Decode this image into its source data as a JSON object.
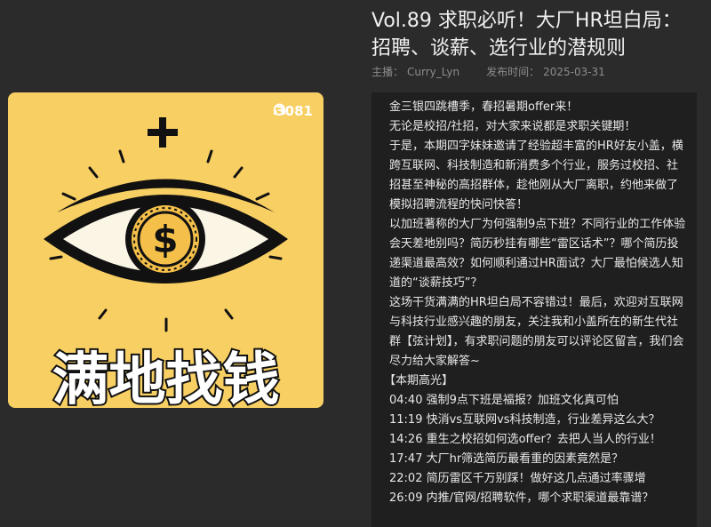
{
  "episode": {
    "title": "Vol.89 求职必听！大厂HR坦白局：招聘、谈薪、选行业的潜规则",
    "host_label": "主播：",
    "host_name": "Curry_Lyn",
    "date_label": "发布时间：",
    "date": "2025-03-31"
  },
  "cover": {
    "play_count": "3081",
    "headphone_icon": "headphone-icon",
    "title_text": "满地找钱",
    "background": "#f8cf63"
  },
  "description": {
    "paragraphs": [
      "金三银四跳槽季，春招暑期offer来！",
      "无论是校招/社招，对大家来说都是求职关键期！",
      "于是，本期四字妹妹邀请了经验超丰富的HR好友小盖，横跨互联网、科技制造和新消费多个行业，服务过校招、社招甚至神秘的高招群体，趁他刚从大厂离职，约他来做了模拟招聘流程的快问快答！",
      "以加班著称的大厂为何强制9点下班？不同行业的工作体验会天差地别吗？简历秒挂有哪些“雷区话术”？哪个简历投递渠道最高效？如何顺利通过HR面试？大厂最怕候选人知道的“谈薪技巧”？",
      "这场干货满满的HR坦白局不容错过！最后，欢迎对互联网与科技行业感兴趣的朋友，关注我和小盖所在的新生代社群【弦计划】，有求职问题的朋友可以评论区留言，我们会尽力给大家解答~"
    ],
    "highlights_title": "【本期高光】",
    "highlights": [
      "04:40 强制9点下班是福报？加班文化真可怕",
      "11:19 快消vs互联网vs科技制造，行业差异这么大？",
      "14:26 重生之校招如何选offer？去把人当人的行业！",
      "17:47 大厂hr筛选简历最看重的因素竟然是？",
      "22:02 简历雷区千万别踩！做好这几点通过率骤增",
      "26:09 内推/官网/招聘软件，哪个求职渠道最靠谱？"
    ]
  }
}
